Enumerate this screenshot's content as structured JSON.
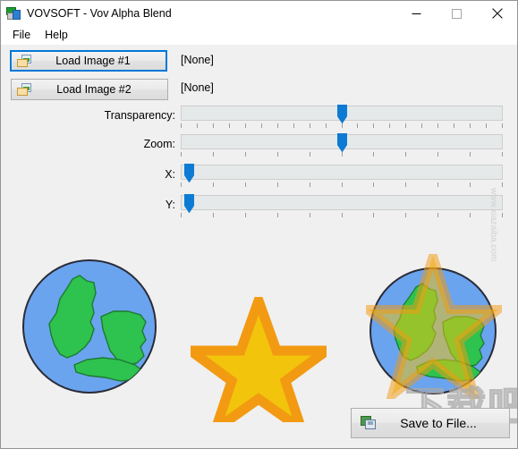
{
  "window": {
    "title": "VOVSOFT - Vov Alpha Blend",
    "icon": "app-blend-icon",
    "controls": {
      "minimize": "minimize-icon",
      "maximize": "maximize-icon",
      "close": "close-icon"
    }
  },
  "menu": {
    "items": [
      {
        "label": "File"
      },
      {
        "label": "Help"
      }
    ]
  },
  "buttons": {
    "load1": {
      "label": "Load Image #1",
      "icon": "open-image-icon",
      "focused": true
    },
    "load2": {
      "label": "Load Image #2",
      "icon": "open-image-icon",
      "focused": false
    },
    "save": {
      "label": "Save to File...",
      "icon": "save-image-icon"
    }
  },
  "file_status": {
    "image1": "[None]",
    "image2": "[None]"
  },
  "sliders": [
    {
      "name": "transparency",
      "label": "Transparency:",
      "value_percent": 50,
      "ticks": 21
    },
    {
      "name": "zoom",
      "label": "Zoom:",
      "value_percent": 50,
      "ticks": 11
    },
    {
      "name": "x",
      "label": "X:",
      "value_percent": 1,
      "ticks": 11
    },
    {
      "name": "y",
      "label": "Y:",
      "value_percent": 1,
      "ticks": 11
    }
  ],
  "previews": {
    "image1": {
      "name": "globe-earth-image",
      "alt": "Blue globe with green landmasses"
    },
    "image2": {
      "name": "star-image",
      "alt": "Yellow five-pointed star with orange outline"
    },
    "blend": {
      "name": "blended-result-image",
      "alt": "Globe blended with semi-transparent star"
    }
  },
  "colors": {
    "accent": "#0078d7",
    "globe_water": "#6aa4ee",
    "globe_land": "#2ec24e",
    "globe_outline": "#2b2b38",
    "star_fill": "#f2c40c",
    "star_stroke": "#f29a12",
    "window_bg": "#f0f0f0",
    "titlebar_bg": "#ffffff",
    "track_bg": "#e6e9ea"
  },
  "watermark": {
    "chinese": "下载吧",
    "url": "www.xiazaiba.com",
    "side": "www.xiazaiba.com"
  }
}
